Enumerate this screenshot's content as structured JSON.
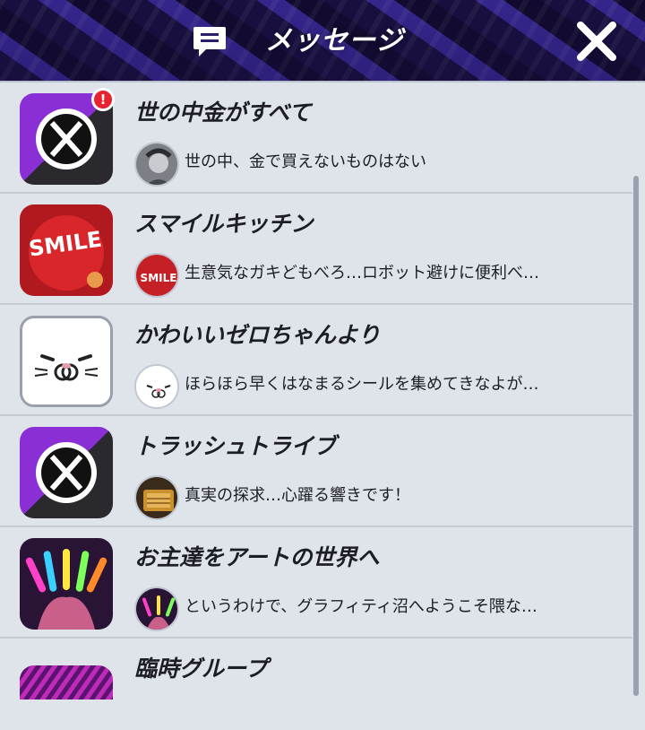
{
  "header": {
    "title": "メッセージ",
    "icon": "message-icon",
    "close_icon": "close-icon"
  },
  "threads": [
    {
      "title": "世の中金がすべて",
      "preview": "世の中、金で買えないものはない",
      "thumb": "x-logo-icon",
      "avatar": "gray-portrait-avatar",
      "badge": "!"
    },
    {
      "title": "スマイルキッチン",
      "preview": "生意気なガキどもべろ…ロボット避けに便利べ…",
      "thumb": "smile-logo",
      "thumb_text": "SMILE",
      "avatar": "smile-avatar",
      "avatar_text": "SMILE"
    },
    {
      "title": "かわいいゼロちゃんより",
      "preview": "ほらほら早くはなまるシールを集めてきなよが…",
      "thumb": "seal-face-icon",
      "avatar": "seal-avatar"
    },
    {
      "title": "トラッシュトライブ",
      "preview": "真実の探求…心躍る響きです！",
      "thumb": "x-logo-icon",
      "avatar": "book-avatar"
    },
    {
      "title": "お主達をアートの世界へ",
      "preview": "というわけで、グラフィティ沼へようこそ隈な…",
      "thumb": "glowsticks-icon",
      "avatar": "glowsticks-avatar"
    },
    {
      "title": "臨時グループ",
      "thumb": "striped-banner-icon"
    }
  ],
  "colors": {
    "accent_red": "#e8222e",
    "header_purple": "#3a2a9a",
    "list_bg": "#dfe3ea"
  }
}
